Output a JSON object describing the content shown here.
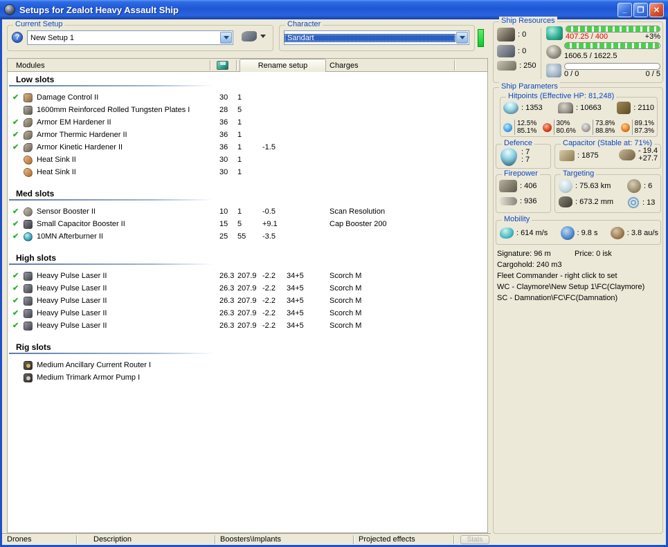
{
  "window": {
    "title": "Setups for Zealot Heavy Assault Ship",
    "minimize": "_",
    "maximize": "❐",
    "close": "✕"
  },
  "current_setup": {
    "label": "Current Setup",
    "value": "New Setup 1",
    "help": "?"
  },
  "character": {
    "label": "Character",
    "value": "Sandart"
  },
  "list_header": {
    "modules": "Modules",
    "rename_setup": "Rename setup",
    "charges": "Charges"
  },
  "ship_resources": {
    "label": "Ship Resources",
    "turrets": ": 0",
    "launchers": ": 0",
    "calibration": ": 250",
    "cpu": {
      "text": "407.25 / 400",
      "extra": "+3%"
    },
    "powergrid": {
      "text": "1606.5 / 1622.5"
    },
    "drones": {
      "left": "0 / 0",
      "right": "0 / 5"
    }
  },
  "ship_parameters": {
    "label": "Ship Parameters",
    "hitpoints": {
      "label": "Hitpoints (Effective HP: 81,248)",
      "shield": ": 1353",
      "armor": ": 10663",
      "hull": ": 2110",
      "resists": [
        {
          "top": "12.5%",
          "bottom": "85.1%"
        },
        {
          "top": "30%",
          "bottom": "80.6%"
        },
        {
          "top": "73.8%",
          "bottom": "88.8%"
        },
        {
          "top": "89.1%",
          "bottom": "87.3%"
        }
      ]
    },
    "defence": {
      "label": "Defence",
      "top": ": 7",
      "bottom": ": 7"
    },
    "capacitor": {
      "label": "Capacitor (Stable at: 71%)",
      "amount": ": 1875",
      "delta_top": "- 19.4",
      "delta_bottom": "+27.7"
    },
    "firepower": {
      "label": "Firepower",
      "volley": ": 406",
      "dps": ": 936"
    },
    "targeting": {
      "label": "Targeting",
      "range": ": 75.63 km",
      "max_targets": ": 6",
      "scan_res": ": 673.2 mm",
      "sensor_str": ": 13"
    },
    "mobility": {
      "label": "Mobility",
      "speed": ": 614 m/s",
      "align": ": 9.8 s",
      "warp": ": 3.8 au/s"
    },
    "info": {
      "signature": "Signature: 96 m",
      "price": "Price: 0 isk",
      "cargohold": "Cargohold: 240 m3",
      "fleet": "Fleet Commander - right click to set",
      "wc": "WC - Claymore\\New Setup 1\\FC(Claymore)",
      "sc": "SC - Damnation\\FC\\FC(Damnation)"
    }
  },
  "slots": [
    {
      "heading": "Low slots",
      "rows": [
        {
          "checked": true,
          "icon": "dc",
          "name": "Damage Control II",
          "c1": "30",
          "c2": "1",
          "c3": "",
          "c4": "",
          "charge": ""
        },
        {
          "checked": false,
          "icon": "plate",
          "name": "1600mm Reinforced Rolled Tungsten Plates I",
          "c1": "28",
          "c2": "5",
          "c3": "",
          "c4": "",
          "charge": ""
        },
        {
          "checked": true,
          "icon": "hardener",
          "name": "Armor EM Hardener II",
          "c1": "36",
          "c2": "1",
          "c3": "",
          "c4": "",
          "charge": ""
        },
        {
          "checked": true,
          "icon": "hardener",
          "name": "Armor Thermic Hardener II",
          "c1": "36",
          "c2": "1",
          "c3": "",
          "c4": "",
          "charge": ""
        },
        {
          "checked": true,
          "icon": "hardener",
          "name": "Armor Kinetic Hardener II",
          "c1": "36",
          "c2": "1",
          "c3": "-1.5",
          "c4": "",
          "charge": ""
        },
        {
          "checked": false,
          "icon": "heatsink",
          "name": "Heat Sink II",
          "c1": "30",
          "c2": "1",
          "c3": "",
          "c4": "",
          "charge": ""
        },
        {
          "checked": false,
          "icon": "heatsink",
          "name": "Heat Sink II",
          "c1": "30",
          "c2": "1",
          "c3": "",
          "c4": "",
          "charge": ""
        }
      ]
    },
    {
      "heading": "Med slots",
      "rows": [
        {
          "checked": true,
          "icon": "sensorbooster",
          "name": "Sensor Booster II",
          "c1": "10",
          "c2": "1",
          "c3": "-0.5",
          "c4": "",
          "charge": "Scan Resolution"
        },
        {
          "checked": true,
          "icon": "capbooster",
          "name": "Small Capacitor Booster II",
          "c1": "15",
          "c2": "5",
          "c3": "+9.1",
          "c4": "",
          "charge": "Cap Booster 200"
        },
        {
          "checked": true,
          "icon": "afterburner",
          "name": "10MN Afterburner II",
          "c1": "25",
          "c2": "55",
          "c3": "-3.5",
          "c4": "",
          "charge": ""
        }
      ]
    },
    {
      "heading": "High slots",
      "rows": [
        {
          "checked": true,
          "icon": "laser",
          "name": "Heavy Pulse Laser II",
          "c1": "26.3",
          "c2": "207.9",
          "c3": "-2.2",
          "c4": "34+5",
          "charge": "Scorch M"
        },
        {
          "checked": true,
          "icon": "laser",
          "name": "Heavy Pulse Laser II",
          "c1": "26.3",
          "c2": "207.9",
          "c3": "-2.2",
          "c4": "34+5",
          "charge": "Scorch M"
        },
        {
          "checked": true,
          "icon": "laser",
          "name": "Heavy Pulse Laser II",
          "c1": "26.3",
          "c2": "207.9",
          "c3": "-2.2",
          "c4": "34+5",
          "charge": "Scorch M"
        },
        {
          "checked": true,
          "icon": "laser",
          "name": "Heavy Pulse Laser II",
          "c1": "26.3",
          "c2": "207.9",
          "c3": "-2.2",
          "c4": "34+5",
          "charge": "Scorch M"
        },
        {
          "checked": true,
          "icon": "laser",
          "name": "Heavy Pulse Laser II",
          "c1": "26.3",
          "c2": "207.9",
          "c3": "-2.2",
          "c4": "34+5",
          "charge": "Scorch M"
        }
      ]
    },
    {
      "heading": "Rig slots",
      "rows": [
        {
          "checked": false,
          "icon": "rig1",
          "name": "Medium Ancillary Current Router I",
          "c1": "",
          "c2": "",
          "c3": "",
          "c4": "",
          "charge": ""
        },
        {
          "checked": false,
          "icon": "rig2",
          "name": "Medium Trimark Armor Pump I",
          "c1": "",
          "c2": "",
          "c3": "",
          "c4": "",
          "charge": ""
        }
      ]
    }
  ],
  "bottom": {
    "tabs": [
      "Drones",
      "Description",
      "Boosters\\Implants",
      "Projected effects"
    ],
    "stats": "Stats"
  }
}
